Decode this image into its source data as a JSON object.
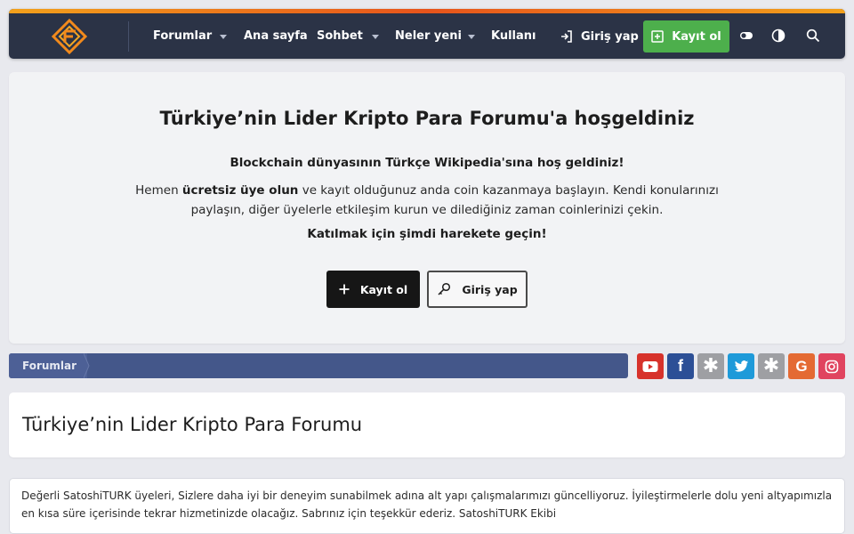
{
  "header": {
    "nav": [
      {
        "label": "Forumlar",
        "has_dropdown": true
      },
      {
        "label": "Ana sayfa",
        "has_dropdown": false
      },
      {
        "label": "Sohbet",
        "has_dropdown": true
      },
      {
        "label": "Neler yeni",
        "has_dropdown": true
      },
      {
        "label": "Kullanıcı",
        "has_dropdown": false
      }
    ],
    "login_label": "Giriş yap",
    "register_label": "Kayıt ol",
    "icons": [
      "logo-icon",
      "toggle-icon",
      "contrast-icon",
      "search-icon"
    ],
    "accent": "#f2a11c",
    "bg": "#2b3346",
    "register_color": "#4daf4c"
  },
  "welcome": {
    "title": "Türkiye’nin Lider Kripto Para Forumu'a hoşgeldiniz",
    "subtitle": "Blockchain dünyasının Türkçe Wikipedia'sına hoş geldiniz!",
    "body_prefix": "Hemen ",
    "body_bold": "ücretsiz üye olun",
    "body_suffix": " ve kayıt olduğunuz anda coin kazanmaya başlayın. Kendi konularınızı paylaşın, diğer üyelerle etkileşim kurun ve dilediğiniz zaman coinlerinizi çekin.",
    "cta": "Katılmak için şimdi harekete geçin!",
    "register_button": "Kayıt ol",
    "login_button": "Giriş yap"
  },
  "breadcrumb": {
    "items": [
      "Forumlar"
    ],
    "color": "#44578a"
  },
  "social": [
    {
      "name": "youtube-icon",
      "color": "#d7322b"
    },
    {
      "name": "facebook-icon",
      "color": "#2c4f96"
    },
    {
      "name": "asterisk-icon",
      "color": "#9e9fa3"
    },
    {
      "name": "twitter-icon",
      "color": "#1e9ad9"
    },
    {
      "name": "asterisk-icon",
      "color": "#9e9fa3"
    },
    {
      "name": "google-icon",
      "color": "#e46a33"
    },
    {
      "name": "instagram-icon",
      "color": "#e0445f"
    }
  ],
  "page": {
    "title": "Türkiye’nin Lider Kripto Para Forumu"
  },
  "notice": {
    "text": "Değerli SatoshiTURK üyeleri, Sizlere daha iyi bir deneyim sunabilmek adına alt yapı çalışmalarımızı güncelliyoruz. İyileştirmelerle dolu yeni altyapımızla en kısa süre içerisinde tekrar hizmetinizde olacağız. Sabrınız için teşekkür ederiz. SatoshiTURK Ekibi"
  }
}
